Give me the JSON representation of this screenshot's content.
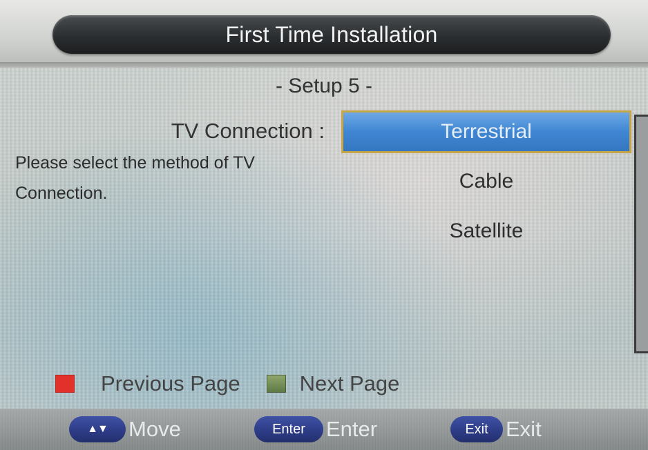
{
  "header": {
    "title": "First Time Installation"
  },
  "setup": {
    "step_label": "- Setup 5 -",
    "field_label": "TV Connection :",
    "help_text": "Please select the method of TV Connection."
  },
  "options": [
    {
      "label": "Terrestrial",
      "selected": true
    },
    {
      "label": "Cable",
      "selected": false
    },
    {
      "label": "Satellite",
      "selected": false
    }
  ],
  "legend": {
    "previous": {
      "label": "Previous Page",
      "color": "#e2312a"
    },
    "next": {
      "label": "Next Page",
      "color": "#6f8a55"
    }
  },
  "footer": {
    "move": {
      "key_icon": "up-down-arrows-icon",
      "label": "Move"
    },
    "enter": {
      "key": "Enter",
      "label": "Enter"
    },
    "exit": {
      "key": "Exit",
      "label": "Exit"
    }
  },
  "colors": {
    "selection": "#3f86d2",
    "selection_border": "#c9a54a",
    "title_bar": "#2b2e30",
    "key_button": "#2d3b85"
  }
}
